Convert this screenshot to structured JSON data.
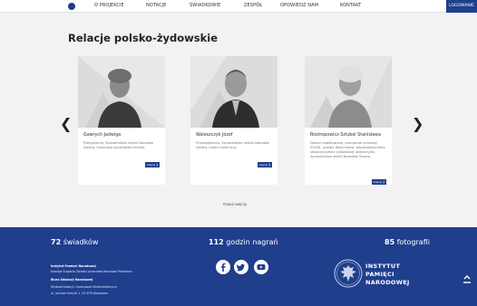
{
  "nav": {
    "items": [
      "O PROJEKCIE",
      "NOTACJE",
      "ŚWIADKOWIE",
      "ZESPÓŁ",
      "OPOWIEDZ NAM",
      "KONTAKT"
    ],
    "login_label": "LOGOWANIE"
  },
  "section": {
    "title": "Relacje polsko-żydowskie"
  },
  "cards": [
    {
      "name": "Gawrych Jadwiga",
      "desc": "Pielęgniarka, Sprawiedliwa wśród Narodów Świata, honorowa obywatelka miasta.",
      "more": "więcej ❯"
    },
    {
      "name": "Waleszczyk Józef",
      "desc": "Przedsiębiorca, Sprawiedliwy wśród Narodów Świata, mistrz kaletniczy.",
      "more": "więcej ❯"
    },
    {
      "name": "Rostropowicz-Szlubel Stanisława",
      "desc": "Doktor habilitowana, pracownik naukowy SGGW, ocalała Wołynianka, współzałożycielka stowarzyszenia żydowskiej dziewczynki, Sprawiedliwa wśród Narodów Świata.",
      "more": "więcej ❯"
    }
  ],
  "show_more": "POKAŻ WIĘCEJ",
  "stats": [
    {
      "number": "72",
      "label": "świadków"
    },
    {
      "number": "112",
      "label": "godzin nagrań"
    },
    {
      "number": "85",
      "label": "fotografii"
    }
  ],
  "footer": {
    "org1": "Instytut Pamięci Narodowej",
    "org1_sub": "Komisja Ścigania Zbrodni przeciwko Narodowi Polskiemu",
    "org2": "Biuro Edukacji Narodowej",
    "org2_sub": "Wydział Notacji i Opracowań Multimedialnych",
    "address": "ul. Janusza Kurtyki 1, 02-676 Warszawa",
    "ipn_lines": [
      "INSTYTUT",
      "PAMIĘCI",
      "NARODOWEJ"
    ]
  },
  "social_icons": [
    "facebook-icon",
    "twitter-icon",
    "youtube-icon"
  ],
  "colors": {
    "brand": "#1f3e8c",
    "background": "#f2f2f2"
  }
}
